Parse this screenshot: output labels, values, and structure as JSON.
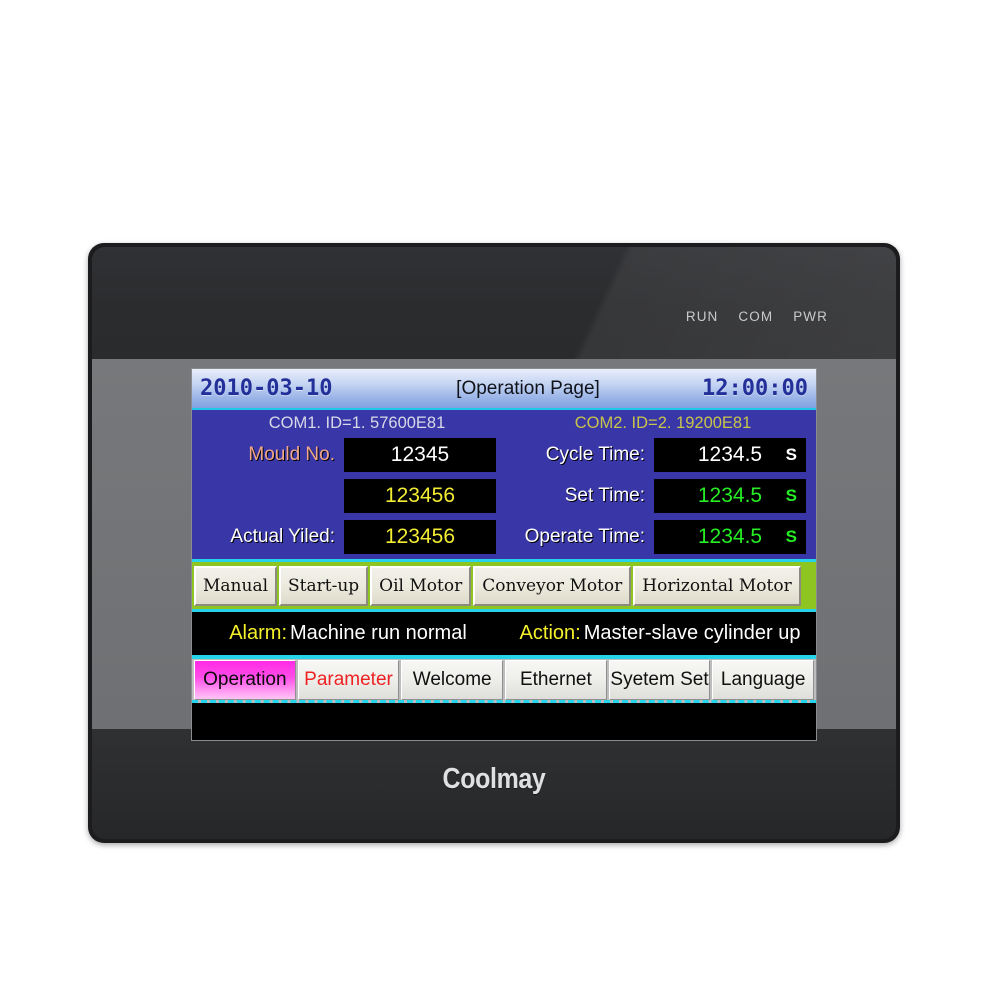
{
  "device": {
    "brand_logo": "Coolmay",
    "led_labels": [
      "RUN",
      "COM",
      "PWR"
    ]
  },
  "screen": {
    "titlebar": {
      "date": "2010-03-10",
      "title": "[Operation Page]",
      "time": "12:00:00"
    },
    "com_ports": {
      "com1": "COM1. ID=1. 57600E81",
      "com2": "COM2. ID=2. 19200E81"
    },
    "left_fields": [
      {
        "label": "Mould No.",
        "value": "12345",
        "unit": "",
        "label_color": "#f2a88c",
        "value_color": "#ffffff"
      },
      {
        "label": "",
        "value": "123456",
        "unit": "",
        "label_color": "#ffffff",
        "value_color": "#f2ec32"
      },
      {
        "label": "Actual Yiled:",
        "value": "123456",
        "unit": "",
        "label_color": "#ffffff",
        "value_color": "#f2ec32"
      }
    ],
    "right_fields": [
      {
        "label": "Cycle Time:",
        "value": "1234.5",
        "unit": "S",
        "label_color": "#ffffff",
        "value_color": "#ffffff"
      },
      {
        "label": "Set Time:",
        "value": "1234.5",
        "unit": "S",
        "label_color": "#ffffff",
        "value_color": "#25ee25"
      },
      {
        "label": "Operate Time:",
        "value": "1234.5",
        "unit": "S",
        "label_color": "#ffffff",
        "value_color": "#25ee25"
      }
    ],
    "control_buttons": [
      {
        "label": "Manual"
      },
      {
        "label": "Start-up"
      },
      {
        "label": "Oil Motor"
      },
      {
        "label": "Conveyor Motor"
      },
      {
        "label": "Horizontal Motor"
      }
    ],
    "status_bar": {
      "alarm_key": "Alarm:",
      "alarm_value": "Machine run normal",
      "action_key": "Action:",
      "action_value": "Master-slave cylinder up"
    },
    "tabs": [
      {
        "label": "Operation",
        "state": "active"
      },
      {
        "label": "Parameter",
        "state": "alert"
      },
      {
        "label": "Welcome",
        "state": "normal"
      },
      {
        "label": "Ethernet",
        "state": "normal"
      },
      {
        "label": "Syetem Set",
        "state": "normal"
      },
      {
        "label": "Language",
        "state": "normal"
      }
    ]
  },
  "colors": {
    "panel_blue": "#3937a8",
    "divider_cyan": "#27d3ea",
    "button_strip_green": "#8fc520",
    "active_tab_magenta": "#ff2ae6",
    "value_yellow": "#f2ec32",
    "value_green": "#25ee25",
    "alarm_key_yellow": "#f4f02a"
  }
}
